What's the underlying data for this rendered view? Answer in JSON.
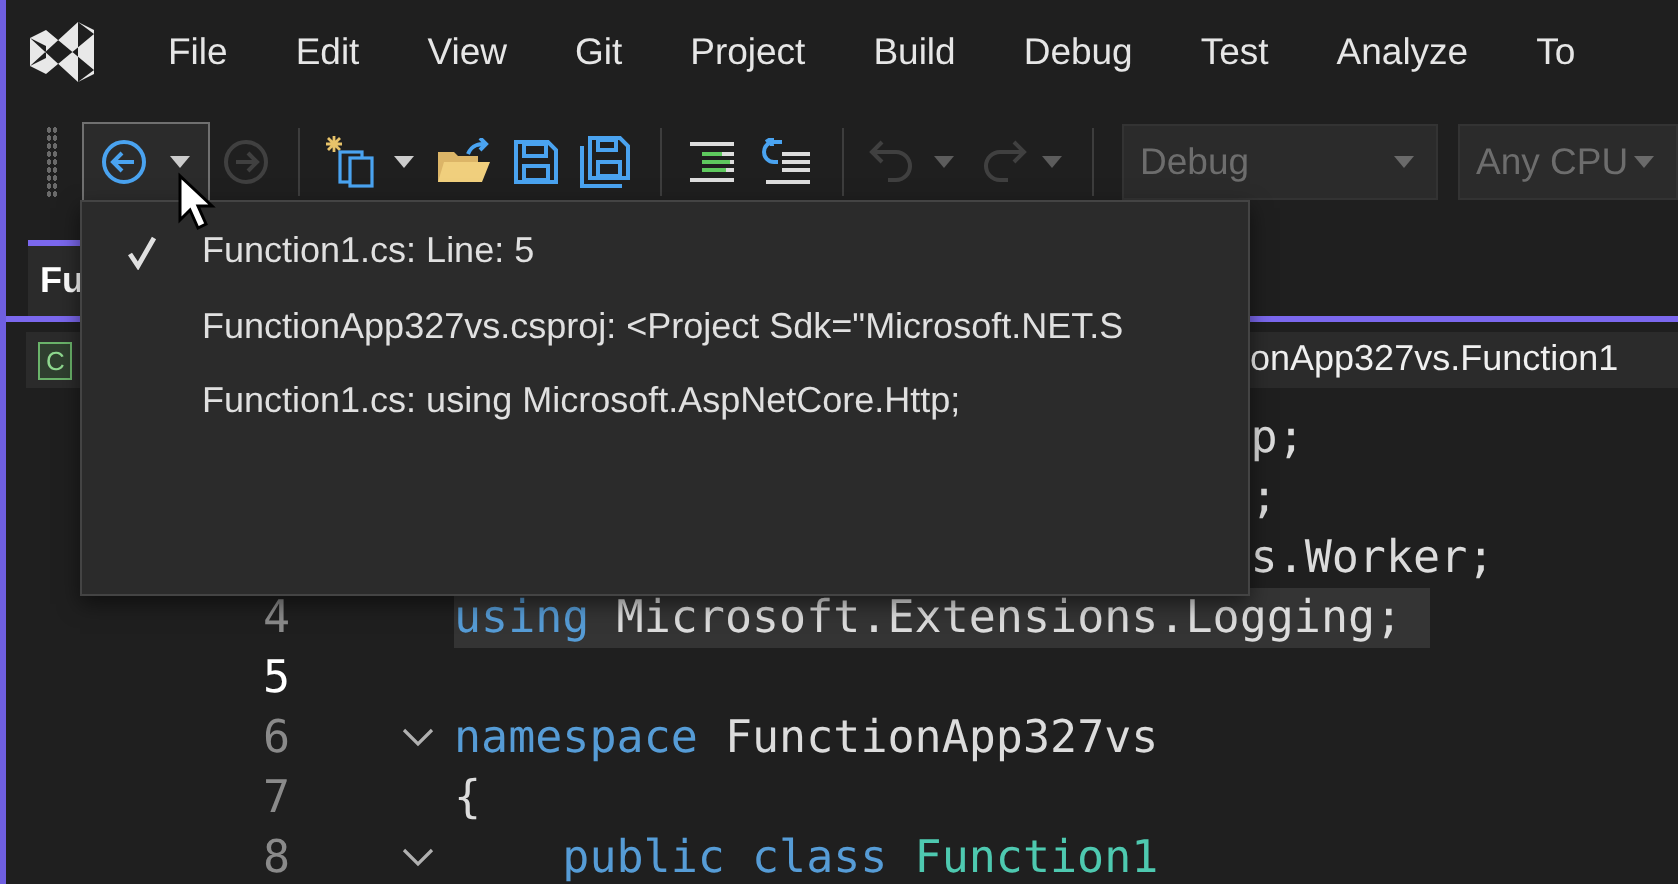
{
  "menu_bar": {
    "items": [
      {
        "label": "File"
      },
      {
        "label": "Edit"
      },
      {
        "label": "View"
      },
      {
        "label": "Git"
      },
      {
        "label": "Project"
      },
      {
        "label": "Build"
      },
      {
        "label": "Debug"
      },
      {
        "label": "Test"
      },
      {
        "label": "Analyze"
      },
      {
        "label": "To"
      }
    ]
  },
  "toolbar": [
    {
      "kind": "back",
      "disabled": false,
      "pressed": true,
      "dropdown": true
    },
    {
      "kind": "forward",
      "disabled": true,
      "pressed": false,
      "dropdown": false
    },
    {
      "kind": "separator"
    },
    {
      "kind": "new-item",
      "disabled": false,
      "pressed": false,
      "dropdown": true
    },
    {
      "kind": "open",
      "disabled": false,
      "pressed": false,
      "dropdown": false
    },
    {
      "kind": "save",
      "disabled": false,
      "pressed": false,
      "dropdown": false
    },
    {
      "kind": "save-all",
      "disabled": false,
      "pressed": false,
      "dropdown": false
    },
    {
      "kind": "separator"
    },
    {
      "kind": "lines",
      "disabled": false,
      "pressed": false,
      "dropdown": false
    },
    {
      "kind": "wrap-lines",
      "disabled": false,
      "pressed": false,
      "dropdown": false
    },
    {
      "kind": "separator"
    },
    {
      "kind": "undo",
      "disabled": true,
      "pressed": false,
      "dropdown": true
    },
    {
      "kind": "redo",
      "disabled": true,
      "pressed": false,
      "dropdown": true
    },
    {
      "kind": "separator"
    },
    {
      "kind": "combo",
      "value": "Debug",
      "disabled": true
    },
    {
      "kind": "combo",
      "value": "Any CPU",
      "disabled": true
    }
  ],
  "document_tab": {
    "title": "Fu",
    "selected": true
  },
  "navigation_bar": {
    "project": "C",
    "member": "onApp327vs.Function1"
  },
  "code_lines": [
    {
      "hidden_start": true,
      "highlighted": false,
      "current": false,
      "indented": false,
      "collapsible": false,
      "tokens": [
        {
          "kind": "plain",
          "text": "p;"
        }
      ]
    },
    {
      "hidden_start": true,
      "highlighted": false,
      "current": false,
      "indented": false,
      "collapsible": false,
      "tokens": [
        {
          "kind": "plain",
          "text": ";"
        }
      ]
    },
    {
      "hidden_start": true,
      "highlighted": false,
      "current": false,
      "indented": false,
      "collapsible": false,
      "tokens": [
        {
          "kind": "plain",
          "text": "s.Worker;"
        }
      ]
    },
    {
      "number": "4",
      "hidden_start": false,
      "highlighted": true,
      "current": false,
      "indented": false,
      "collapsible": false,
      "tokens": [
        {
          "kind": "keyword",
          "text": "using"
        },
        {
          "kind": "plain",
          "text": " Microsoft.Extensions.Logging;"
        }
      ]
    },
    {
      "number": "5",
      "hidden_start": false,
      "highlighted": false,
      "current": true,
      "indented": false,
      "collapsible": false
    },
    {
      "number": "6",
      "hidden_start": false,
      "highlighted": false,
      "current": false,
      "indented": false,
      "collapsible": true,
      "tokens": [
        {
          "kind": "keyword",
          "text": "namespace"
        },
        {
          "kind": "plain",
          "text": " FunctionApp327vs"
        }
      ]
    },
    {
      "number": "7",
      "hidden_start": false,
      "highlighted": false,
      "current": false,
      "indented": false,
      "collapsible": false,
      "tokens": [
        {
          "kind": "plain",
          "text": "{"
        }
      ]
    },
    {
      "number": "8",
      "hidden_start": false,
      "highlighted": false,
      "current": false,
      "indented": true,
      "collapsible": true,
      "tokens": [
        {
          "kind": "keyword",
          "text": "public class"
        },
        {
          "kind": "type",
          "text": " Function1"
        }
      ]
    }
  ],
  "navigation_popup": {
    "items": [
      {
        "text": "Function1.cs: Line: 5",
        "checked": true
      },
      {
        "text": "FunctionApp327vs.csproj: <Project Sdk=\"Microsoft.NET.S",
        "checked": false
      },
      {
        "text": "Function1.cs: using Microsoft.AspNetCore.Http;",
        "checked": false
      }
    ]
  }
}
